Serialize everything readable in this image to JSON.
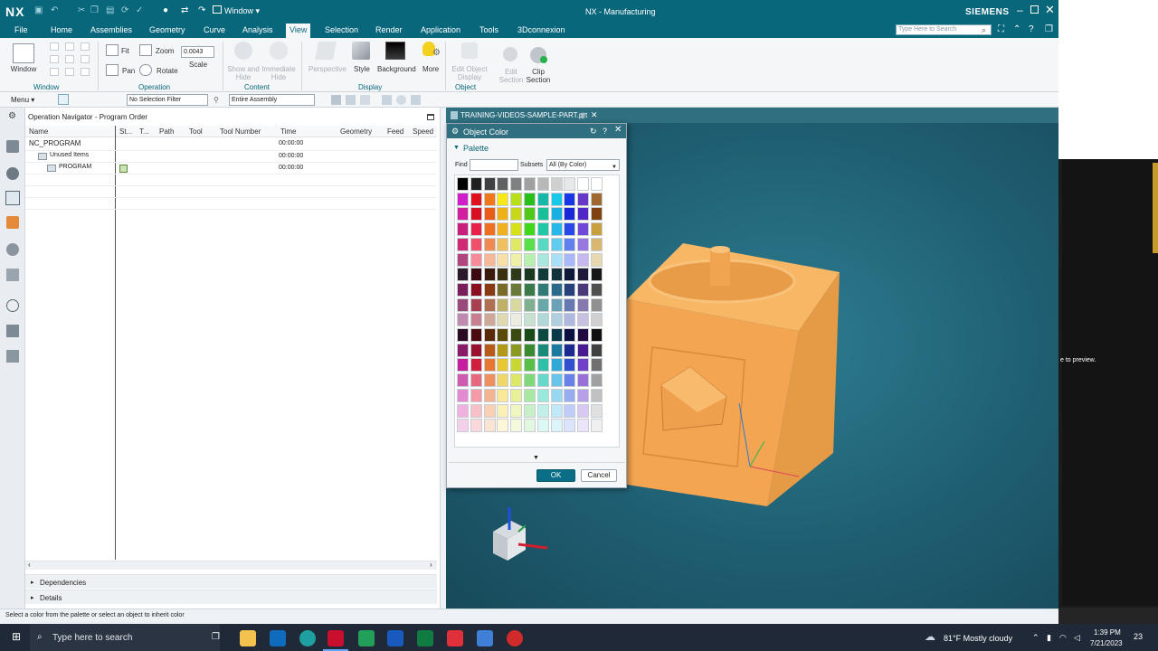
{
  "app": {
    "logo": "NX",
    "quick_window": "Window ▾",
    "title": "NX - Manufacturing",
    "brand": "SIEMENS",
    "search_placeholder": "Type Here to Search"
  },
  "menu": [
    "File",
    "Home",
    "Assemblies",
    "Geometry",
    "Curve",
    "Analysis",
    "View",
    "Selection",
    "Render",
    "Application",
    "Tools",
    "3Dconnexion"
  ],
  "active_menu": "View",
  "ribbon": {
    "window_label": "Window",
    "fit": "Fit",
    "pan": "Pan",
    "zoom": "Zoom",
    "rotate": "Rotate",
    "scale_value": "0.0043",
    "scale_label": "Scale",
    "show_hide": "Show and Hide",
    "immediate_hide": "Immediate Hide",
    "perspective": "Perspective",
    "style": "Style",
    "background": "Background",
    "more": "More",
    "edit_object_display": "Edit Object Display",
    "edit_section": "Edit Section",
    "clip_section": "Clip Section",
    "groups": {
      "window": "Window",
      "operation": "Operation",
      "content": "Content",
      "display": "Display",
      "object": "Object"
    }
  },
  "toolbar2": {
    "menu": "Menu ▾",
    "selection_filter": "No Selection Filter",
    "assembly_scope": "Entire Assembly"
  },
  "navigator": {
    "title": "Operation Navigator - Program Order",
    "columns": [
      "Name",
      "St...",
      "T...",
      "Path",
      "Tool",
      "Tool Number",
      "Time",
      "Geometry",
      "Feed",
      "Speed"
    ],
    "rows": [
      {
        "name": "NC_PROGRAM",
        "time": "00:00:00"
      },
      {
        "name": "Unused Items",
        "time": "00:00:00"
      },
      {
        "name": "PROGRAM",
        "time": "00:00:00"
      }
    ],
    "dependencies": "Dependencies",
    "details": "Details"
  },
  "graphics_tab": "TRAINING-VIDEOS-SAMPLE-PART.prt",
  "dialog": {
    "title": "Object Color",
    "section": "Palette",
    "find_label": "Find",
    "find_value": "",
    "subsets_label": "Subsets",
    "subsets_value": "All (By Color)",
    "ok": "OK",
    "cancel": "Cancel"
  },
  "palette_columns": [
    [
      "#000000",
      "#d01fc8",
      "#d21f9e",
      "#c81f7e",
      "#d02a76",
      "#b0467d",
      "#2a1a2a",
      "#7a1f5a",
      "#9a4a7a",
      "#c08ab0",
      "#2a0a22",
      "#8a1a6a",
      "#c41f9c",
      "#d05cb0",
      "#e48ad0",
      "#f0b0e0",
      "#f4d0ea"
    ],
    [
      "#202020",
      "#e0101c",
      "#d81022",
      "#e8204a",
      "#f0506a",
      "#f88a9a",
      "#3a0a10",
      "#8a1020",
      "#a84050",
      "#c88090",
      "#4a0a10",
      "#9a1030",
      "#d0203e",
      "#e86880",
      "#f49aa8",
      "#f8c0c8",
      "#fad8dc"
    ],
    [
      "#404040",
      "#f07818",
      "#e85c18",
      "#f07020",
      "#f08a50",
      "#f8b898",
      "#3a1a0a",
      "#8a3a10",
      "#b07050",
      "#d0a898",
      "#5a2a08",
      "#b85a18",
      "#e87830",
      "#f09060",
      "#f4b490",
      "#f8d0b4",
      "#fae4d4"
    ],
    [
      "#606060",
      "#f8e818",
      "#f0b018",
      "#f0b020",
      "#f0c060",
      "#f8e0a8",
      "#3a3010",
      "#7a6a28",
      "#c0b068",
      "#e0d8b0",
      "#5a4a08",
      "#b09a18",
      "#e8c830",
      "#f0d868",
      "#f8e898",
      "#fbf0b8",
      "#fdf6d8"
    ],
    [
      "#808080",
      "#b8e018",
      "#c8d818",
      "#d8e018",
      "#e0e868",
      "#eef0a8",
      "#30381a",
      "#6a7a38",
      "#d8d8a0",
      "#ecece0",
      "#3a4a10",
      "#8a9a20",
      "#c8d830",
      "#dce868",
      "#e8f098",
      "#f0f6c0",
      "#f6fadc"
    ],
    [
      "#a0a0a0",
      "#28c018",
      "#50c818",
      "#40d818",
      "#58e048",
      "#b8f0b0",
      "#1a3a20",
      "#3a7a48",
      "#80b090",
      "#c8e0d0",
      "#1a4a18",
      "#3a8a30",
      "#58c048",
      "#80d878",
      "#a8e8a0",
      "#c8f0c8",
      "#e0f8e0"
    ],
    [
      "#b8b8b8",
      "#18b8a8",
      "#18c098",
      "#20c8a8",
      "#58d8c0",
      "#a8e8dc",
      "#103a38",
      "#307a78",
      "#68a8a8",
      "#b0d8d8",
      "#0a4a40",
      "#1a8a78",
      "#30c0a8",
      "#68d8c8",
      "#98e8dc",
      "#c0f0e8",
      "#dcf8f4"
    ],
    [
      "#d0d0d0",
      "#18c8e8",
      "#18b0e0",
      "#28b8e8",
      "#60ccf0",
      "#a8e0f8",
      "#10303a",
      "#2a6a8a",
      "#6aa0b8",
      "#b0d0e0",
      "#0a3a4a",
      "#1a7aa0",
      "#30a8d8",
      "#68c4e8",
      "#98d8f0",
      "#c0e8f8",
      "#dcf4fc"
    ],
    [
      "#e8e8e8",
      "#1838e8",
      "#1828d8",
      "#2848e8",
      "#6080f0",
      "#a8b8f8",
      "#10183a",
      "#28407a",
      "#6878b0",
      "#b0b8e0",
      "#0a1040",
      "#1a2a90",
      "#3050d0",
      "#6880e8",
      "#98acf0",
      "#c0ccf8",
      "#dce4fc"
    ],
    [
      "#ffffff",
      "#6838c8",
      "#5028c8",
      "#7048d8",
      "#9878e0",
      "#c8b8f0",
      "#201838",
      "#4a3a7a",
      "#8878b0",
      "#c8c0e0",
      "#200a40",
      "#4a1a90",
      "#7040c8",
      "#9870d8",
      "#b8a0e8",
      "#d8c8f4",
      "#ece4fa"
    ],
    [
      "#ffffff",
      "#a06830",
      "#804010",
      "#c8a040",
      "#d8b870",
      "#e8d8b0",
      "#181818",
      "#505050",
      "#909090",
      "#d0d0d0",
      "#101010",
      "#404040",
      "#707070",
      "#a0a0a0",
      "#c0c0c0",
      "#e0e0e0",
      "#f0f0f0"
    ]
  ],
  "status_text": "Select a color from the palette or select an object to inherit color",
  "right_hint": "e to preview.",
  "taskbar": {
    "search_placeholder": "Type here to search",
    "weather": "81°F  Mostly cloudy",
    "time": "1:39 PM",
    "date": "7/21/2023",
    "notifications": "23"
  },
  "colors": {
    "accent": "#09677c",
    "part": "#f5a24a",
    "viewport": "#1f5e72"
  },
  "icons": [
    "undo-icon",
    "redo-icon",
    "save-icon",
    "window-icon",
    "fit-icon",
    "pan-icon",
    "zoom-icon",
    "rotate-icon",
    "perspective-icon",
    "style-icon",
    "background-icon",
    "more-icon",
    "close-icon",
    "help-icon",
    "refresh-icon",
    "triangle-down-icon",
    "folder-icon",
    "search-icon",
    "windows-start-icon",
    "task-view-icon",
    "file-explorer-icon",
    "outlook-icon",
    "edge-icon",
    "nx-icon",
    "word-icon",
    "excel-icon",
    "weather-icon",
    "speaker-icon",
    "wifi-icon"
  ]
}
